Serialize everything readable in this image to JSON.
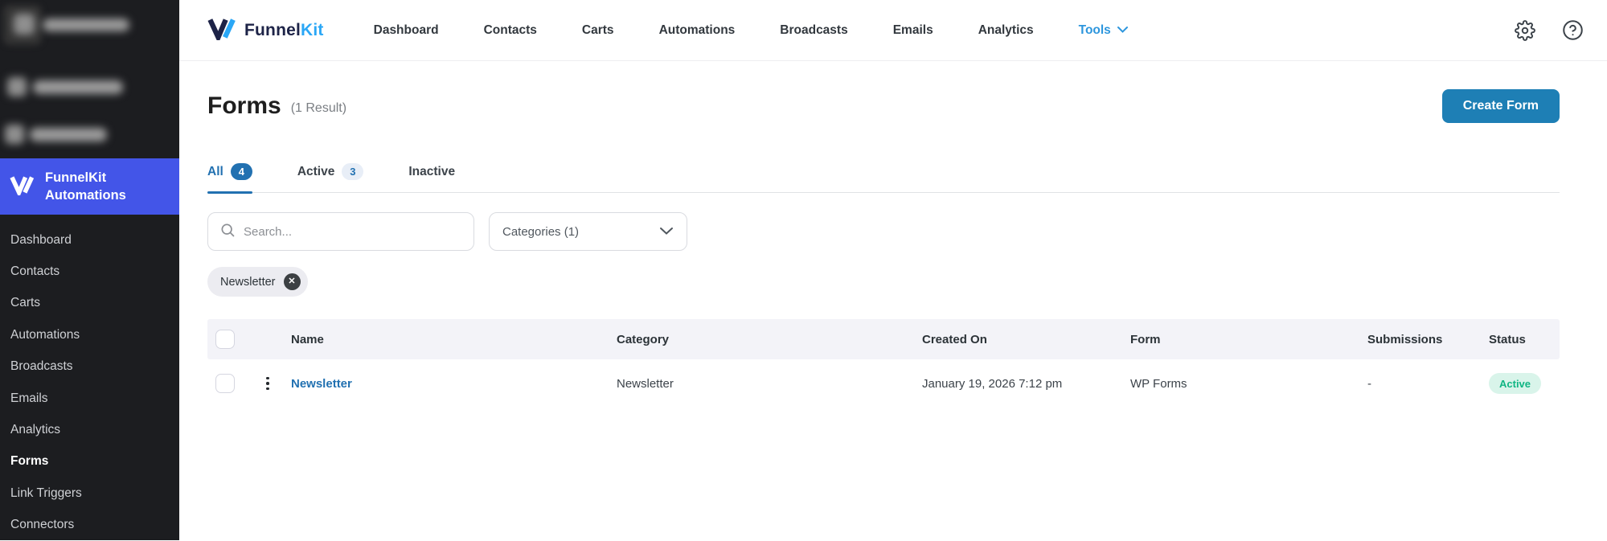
{
  "topbar": {
    "brand": {
      "part1": "Funnel",
      "part2": "Kit"
    },
    "nav": [
      "Dashboard",
      "Contacts",
      "Carts",
      "Automations",
      "Broadcasts",
      "Emails",
      "Analytics"
    ],
    "tools_label": "Tools"
  },
  "sidebar": {
    "plugin_line1": "FunnelKit",
    "plugin_line2": "Automations",
    "items": [
      "Dashboard",
      "Contacts",
      "Carts",
      "Automations",
      "Broadcasts",
      "Emails",
      "Analytics",
      "Forms",
      "Link Triggers",
      "Connectors"
    ],
    "active_item": "Forms"
  },
  "page": {
    "title": "Forms",
    "result_count": "(1 Result)",
    "create_button": "Create Form",
    "tabs": [
      {
        "label": "All",
        "badge": "4",
        "active": true
      },
      {
        "label": "Active",
        "badge": "3",
        "active": false
      },
      {
        "label": "Inactive",
        "badge": "",
        "active": false
      }
    ],
    "search_placeholder": "Search...",
    "categories_label": "Categories (1)",
    "filter_chip": "Newsletter"
  },
  "table": {
    "headers": [
      "Name",
      "Category",
      "Created On",
      "Form",
      "Submissions",
      "Status"
    ],
    "rows": [
      {
        "name": "Newsletter",
        "category": "Newsletter",
        "created_on": "January 19, 2026 7:12 pm",
        "form": "WP Forms",
        "submissions": "-",
        "status": "Active"
      }
    ]
  },
  "colors": {
    "sidebar_bg": "#1c1d20",
    "sidebar_active_bg": "#4355e8",
    "brand_navy": "#1d2347",
    "brand_blue": "#2aa7f6",
    "link_blue": "#2271b1",
    "tools_blue": "#2d96dd",
    "create_button_bg": "#1e7fb5",
    "table_header_bg": "#f3f3f8",
    "status_active_bg": "#d9f4ea",
    "status_active_text": "#10b583"
  }
}
